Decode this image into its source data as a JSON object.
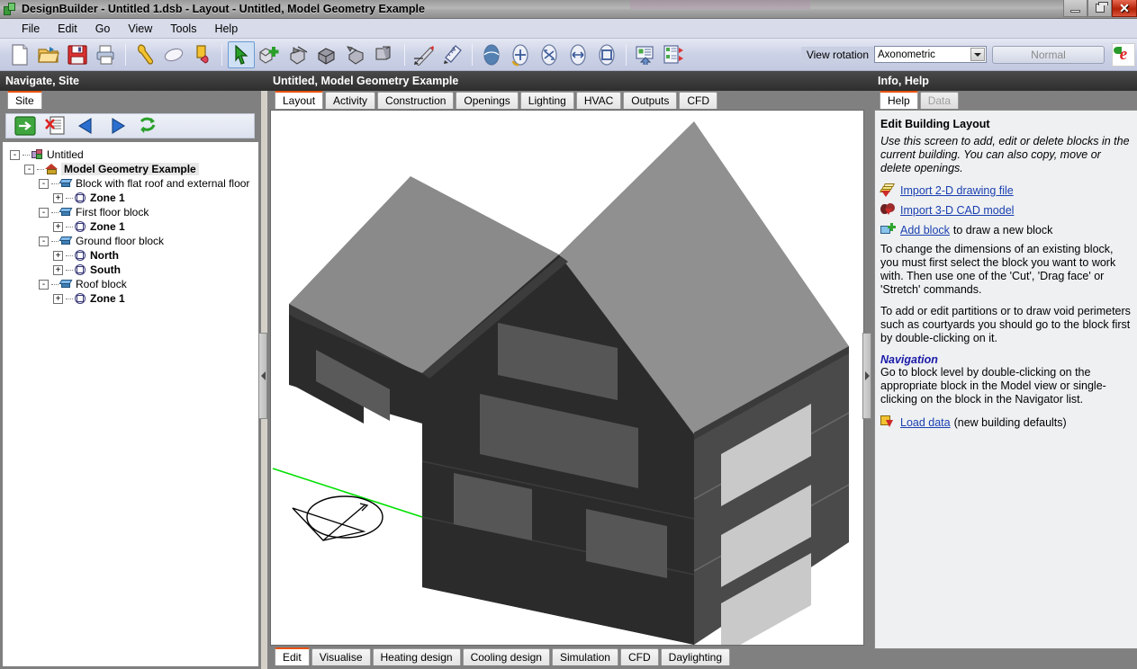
{
  "window": {
    "title": "DesignBuilder - Untitled 1.dsb - Layout - Untitled, Model Geometry Example",
    "app_icon": "designbuilder-logo-icon",
    "minimize_label": "",
    "maximize_label": "",
    "close_label": "✕"
  },
  "menu": {
    "items": [
      {
        "label": "File"
      },
      {
        "label": "Edit"
      },
      {
        "label": "Go"
      },
      {
        "label": "View"
      },
      {
        "label": "Tools"
      },
      {
        "label": "Help"
      }
    ]
  },
  "toolbar": {
    "buttons": [
      {
        "name": "new-file-icon",
        "tip": "New"
      },
      {
        "name": "open-folder-icon",
        "tip": "Open"
      },
      {
        "name": "save-floppy-icon",
        "tip": "Save"
      },
      {
        "name": "print-icon",
        "tip": "Print"
      },
      {
        "name": "wrench-icon",
        "tip": "Model options"
      },
      {
        "name": "eraser-icon",
        "tip": "Clear"
      },
      {
        "name": "undo-icon",
        "tip": "Undo"
      },
      {
        "name": "select-arrow-icon",
        "tip": "Select",
        "active": true
      },
      {
        "name": "add-block-icon",
        "tip": "Add new block"
      },
      {
        "name": "cut-block-icon",
        "tip": "Cut block"
      },
      {
        "name": "drag-face-icon",
        "tip": "Drag face"
      },
      {
        "name": "stretch-icon",
        "tip": "Stretch"
      },
      {
        "name": "clone-block-icon",
        "tip": "Clone block"
      },
      {
        "name": "draw-line-icon",
        "tip": "Draw line"
      },
      {
        "name": "measure-ruler-icon",
        "tip": "Measure"
      },
      {
        "name": "orbit-icon",
        "tip": "Orbit view"
      },
      {
        "name": "zoom-in-icon",
        "tip": "Zoom in"
      },
      {
        "name": "zoom-extents-icon",
        "tip": "Zoom extents"
      },
      {
        "name": "pan-icon",
        "tip": "Pan"
      },
      {
        "name": "zoom-window-icon",
        "tip": "Zoom window"
      },
      {
        "name": "import-data-icon",
        "tip": "Import data"
      },
      {
        "name": "export-data-icon",
        "tip": "Export data"
      }
    ],
    "view_rotation_label": "View rotation",
    "view_rotation_value": "Axonometric",
    "view_rotation_options": [
      "Axonometric"
    ],
    "normal_button_label": "Normal",
    "brand_logo": "energyplus-e-logo"
  },
  "left_panel": {
    "header": "Navigate, Site",
    "tabs": [
      {
        "label": "Site",
        "selected": true
      }
    ],
    "nav_buttons": [
      {
        "name": "go-to-icon"
      },
      {
        "name": "delete-icon"
      },
      {
        "name": "back-arrow-icon"
      },
      {
        "name": "forward-arrow-icon"
      },
      {
        "name": "refresh-icon"
      }
    ],
    "tree": [
      {
        "label": "Untitled",
        "level": 0,
        "icon": "site-icon",
        "expander": "-",
        "bold": false,
        "selected": false
      },
      {
        "label": "Model Geometry Example",
        "level": 1,
        "icon": "building-icon",
        "expander": "-",
        "bold": true,
        "selected": true
      },
      {
        "label": "Block with flat roof and external floor",
        "level": 2,
        "icon": "block-icon",
        "expander": "-",
        "bold": false,
        "selected": false
      },
      {
        "label": "Zone 1",
        "level": 3,
        "icon": "zone-icon",
        "expander": "+",
        "bold": true,
        "selected": false
      },
      {
        "label": "First floor block",
        "level": 2,
        "icon": "block-icon",
        "expander": "-",
        "bold": false,
        "selected": false
      },
      {
        "label": "Zone 1",
        "level": 3,
        "icon": "zone-icon",
        "expander": "+",
        "bold": true,
        "selected": false
      },
      {
        "label": "Ground floor block",
        "level": 2,
        "icon": "block-icon",
        "expander": "-",
        "bold": false,
        "selected": false
      },
      {
        "label": "North",
        "level": 3,
        "icon": "zone-icon",
        "expander": "+",
        "bold": true,
        "selected": false
      },
      {
        "label": "South",
        "level": 3,
        "icon": "zone-icon",
        "expander": "+",
        "bold": true,
        "selected": false
      },
      {
        "label": "Roof block",
        "level": 2,
        "icon": "block-icon",
        "expander": "-",
        "bold": false,
        "selected": false
      },
      {
        "label": "Zone 1",
        "level": 3,
        "icon": "zone-icon",
        "expander": "+",
        "bold": true,
        "selected": false
      }
    ]
  },
  "center_panel": {
    "header": "Untitled, Model Geometry Example",
    "top_tabs": [
      {
        "label": "Layout",
        "selected": true
      },
      {
        "label": "Activity",
        "selected": false
      },
      {
        "label": "Construction",
        "selected": false
      },
      {
        "label": "Openings",
        "selected": false
      },
      {
        "label": "Lighting",
        "selected": false
      },
      {
        "label": "HVAC",
        "selected": false
      },
      {
        "label": "Outputs",
        "selected": false
      },
      {
        "label": "CFD",
        "selected": false
      }
    ],
    "bottom_tabs": [
      {
        "label": "Edit",
        "selected": true
      },
      {
        "label": "Visualise",
        "selected": false
      },
      {
        "label": "Heating design",
        "selected": false
      },
      {
        "label": "Cooling design",
        "selected": false
      },
      {
        "label": "Simulation",
        "selected": false
      },
      {
        "label": "CFD",
        "selected": false
      },
      {
        "label": "Daylighting",
        "selected": false
      }
    ],
    "viewport": {
      "background": "#ffffff",
      "north_axis_color": "#00e000",
      "wall_color": "#2e2e2e",
      "roof_light_color": "#8a8a8a",
      "roof_mid_color": "#7a7a7a",
      "window_dark_color": "#5a5a5a",
      "window_light_color": "#c8c8c8",
      "compass_name": "north-arrow-compass"
    }
  },
  "right_panel": {
    "header": "Info, Help",
    "tabs": [
      {
        "label": "Help",
        "selected": true,
        "disabled": false
      },
      {
        "label": "Data",
        "selected": false,
        "disabled": true
      }
    ],
    "help": {
      "title": "Edit Building Layout",
      "intro": "Use this screen to add, edit or delete blocks in the current building. You can also copy, move or delete openings.",
      "links": [
        {
          "icon": "import-2d-drawing-icon",
          "text": "Import 2-D drawing file",
          "after": ""
        },
        {
          "icon": "import-3d-cad-icon",
          "text": "Import 3-D CAD model",
          "after": ""
        },
        {
          "icon": "add-block-icon",
          "text": "Add block",
          "after": "to draw a new block"
        }
      ],
      "para1": "To change the dimensions of an existing block, you must first select the block you want to work with. Then use one of the 'Cut', 'Drag face' or 'Stretch' commands.",
      "para2": "To add or edit partitions or to draw void perimeters such as courtyards you should go to the block first by double-clicking on it.",
      "nav_heading": "Navigation",
      "nav_text": "Go to block level by double-clicking on the appropriate block in the Model view or single-clicking on the block in the Navigator list.",
      "load_link": {
        "icon": "load-data-icon",
        "text": "Load data",
        "after": "(new building defaults)"
      }
    }
  }
}
